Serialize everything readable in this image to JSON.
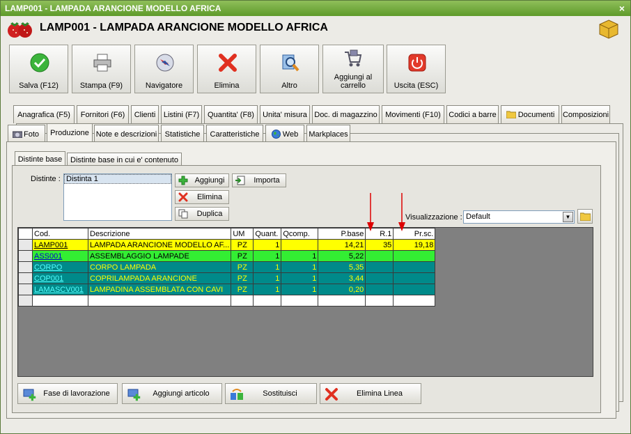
{
  "window": {
    "title": "LAMP001 - LAMPADA ARANCIONE MODELLO AFRICA",
    "close_label": "×"
  },
  "header": {
    "title": "LAMP001 - LAMPADA ARANCIONE MODELLO AFRICA"
  },
  "toolbar": {
    "save": "Salva (F12)",
    "print": "Stampa (F9)",
    "navigator": "Navigatore",
    "delete": "Elimina",
    "other": "Altro",
    "cart": "Aggiungi al carrello",
    "exit": "Uscita (ESC)"
  },
  "tabs_row1": [
    "Anagrafica (F5)",
    "Fornitori (F6)",
    "Clienti",
    "Listini (F7)",
    "Quantita' (F8)",
    "Unita' misura",
    "Doc. di magazzino",
    "Movimenti (F10)",
    "Codici a barre",
    "Documenti",
    "Composizioni"
  ],
  "tabs_row2": [
    "Foto",
    "Produzione",
    "Note e descrizioni",
    "Statistiche",
    "Caratteristiche",
    "Web",
    "Markplaces"
  ],
  "subtabs": [
    "Distinte base",
    "Distinte base in cui e' contenuto"
  ],
  "distinte": {
    "label": "Distinte :",
    "items": [
      "Distinta 1"
    ],
    "add": "Aggiungi",
    "import": "Importa",
    "delete": "Elimina",
    "duplicate": "Duplica"
  },
  "visualizzazione": {
    "label": "Visualizzazione :",
    "value": "Default"
  },
  "grid": {
    "headers": [
      "Cod.",
      "Descrizione",
      "UM",
      "Quant.",
      "Qcomp.",
      "P.base",
      "R.1",
      "Pr.sc."
    ],
    "rows": [
      {
        "style": "yellow",
        "cod": "LAMP001",
        "desc": "LAMPADA ARANCIONE MODELLO AF...",
        "um": "PZ",
        "quant": "1",
        "qcomp": "",
        "pbase": "14,21",
        "r1": "35",
        "prsc": "19,18"
      },
      {
        "style": "green",
        "cod": "ASS001",
        "desc": "ASSEMBLAGGIO LAMPADE",
        "um": "PZ",
        "quant": "1",
        "qcomp": "1",
        "pbase": "5,22",
        "r1": "",
        "prsc": ""
      },
      {
        "style": "teal",
        "cod": "CORPO",
        "desc": "CORPO LAMPADA",
        "um": "PZ",
        "quant": "1",
        "qcomp": "1",
        "pbase": "5,35",
        "r1": "",
        "prsc": ""
      },
      {
        "style": "teal",
        "cod": "COP001",
        "desc": "COPRILAMPADA ARANCIONE",
        "um": "PZ",
        "quant": "1",
        "qcomp": "1",
        "pbase": "3,44",
        "r1": "",
        "prsc": ""
      },
      {
        "style": "teal",
        "cod": "LAMASCV001",
        "desc": "LAMPADINA ASSEMBLATA CON CAVI",
        "um": "PZ",
        "quant": "1",
        "qcomp": "1",
        "pbase": "0,20",
        "r1": "",
        "prsc": ""
      },
      {
        "style": "white",
        "cod": "",
        "desc": "",
        "um": "",
        "quant": "",
        "qcomp": "",
        "pbase": "",
        "r1": "",
        "prsc": ""
      }
    ]
  },
  "bottom_buttons": {
    "phase": "Fase di lavorazione",
    "add_item": "Aggiungi articolo",
    "replace": "Sostituisci",
    "delete_line": "Elimina Linea"
  },
  "colors": {
    "titlebar": "#5e9a2a",
    "row_yellow": "#ffff00",
    "row_green": "#33ee33",
    "row_teal": "#008a8a",
    "arrow": "#dd0000"
  }
}
